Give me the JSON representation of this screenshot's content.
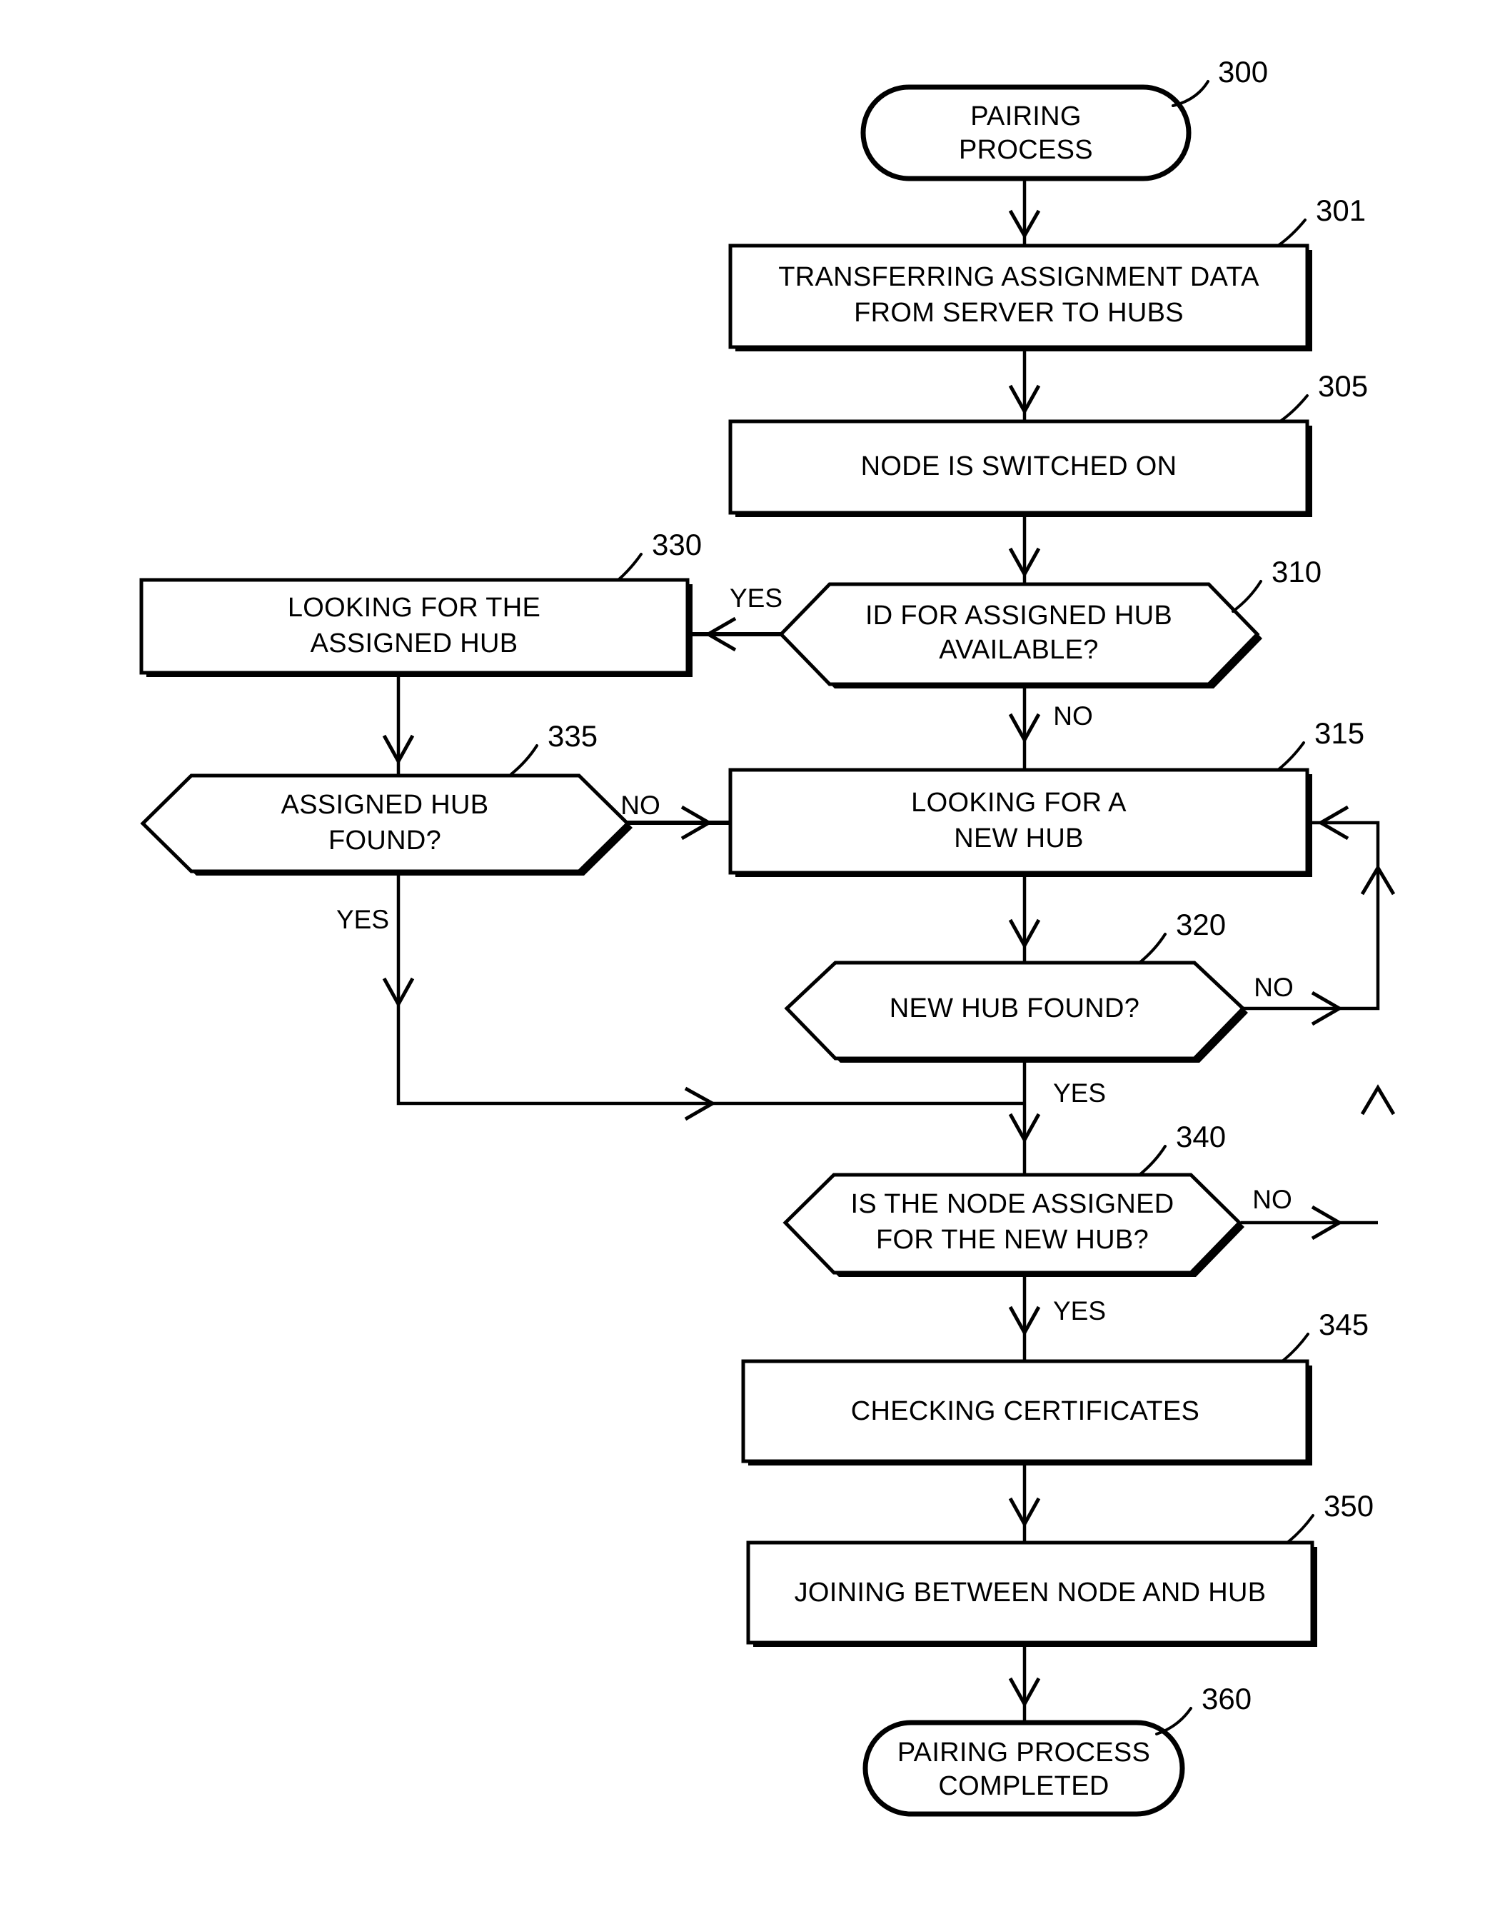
{
  "diagram": {
    "title": "Pairing Process Flowchart",
    "type": "flowchart",
    "background_color": "#ffffff",
    "line_color": "#000000"
  },
  "nodes": {
    "n300": {
      "ref": "300",
      "shape": "terminator",
      "line1": "PAIRING",
      "line2": "PROCESS"
    },
    "n301": {
      "ref": "301",
      "shape": "process",
      "line1": "TRANSFERRING ASSIGNMENT DATA",
      "line2": "FROM SERVER TO HUBS"
    },
    "n305": {
      "ref": "305",
      "shape": "process",
      "line1": "NODE IS SWITCHED ON",
      "line2": ""
    },
    "n310": {
      "ref": "310",
      "shape": "decision",
      "line1": "ID FOR ASSIGNED HUB",
      "line2": "AVAILABLE?"
    },
    "n330": {
      "ref": "330",
      "shape": "process",
      "line1": "LOOKING FOR THE",
      "line2": "ASSIGNED HUB"
    },
    "n335": {
      "ref": "335",
      "shape": "decision",
      "line1": "ASSIGNED HUB",
      "line2": "FOUND?"
    },
    "n315": {
      "ref": "315",
      "shape": "process",
      "line1": "LOOKING FOR A",
      "line2": "NEW HUB"
    },
    "n320": {
      "ref": "320",
      "shape": "decision",
      "line1": "NEW HUB FOUND?",
      "line2": ""
    },
    "n340": {
      "ref": "340",
      "shape": "decision",
      "line1": "IS THE NODE ASSIGNED",
      "line2": "FOR THE NEW HUB?"
    },
    "n345": {
      "ref": "345",
      "shape": "process",
      "line1": "CHECKING CERTIFICATES",
      "line2": ""
    },
    "n350": {
      "ref": "350",
      "shape": "process",
      "line1": "JOINING BETWEEN NODE AND HUB",
      "line2": ""
    },
    "n360": {
      "ref": "360",
      "shape": "terminator",
      "line1": "PAIRING PROCESS",
      "line2": "COMPLETED"
    }
  },
  "edge_labels": {
    "e310_yes": "YES",
    "e310_no": "NO",
    "e335_no": "NO",
    "e335_yes": "YES",
    "e320_no": "NO",
    "e320_yes": "YES",
    "e340_no": "NO",
    "e340_yes": "YES"
  }
}
